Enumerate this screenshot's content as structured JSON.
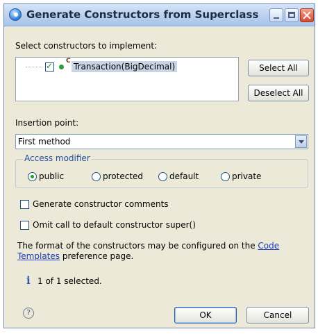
{
  "window": {
    "title": "Generate Constructors from Superclass"
  },
  "constructors": {
    "label": "Select constructors to implement:",
    "items": [
      {
        "label": "Transaction(BigDecimal)",
        "checked": true,
        "badge": "C"
      }
    ],
    "select_all": "Select All",
    "deselect_all": "Deselect All"
  },
  "insertion": {
    "label": "Insertion point:",
    "value": "First method"
  },
  "access": {
    "title": "Access modifier",
    "options": [
      "public",
      "protected",
      "default",
      "private"
    ],
    "selected": "public"
  },
  "options": {
    "generate_comments": "Generate constructor comments",
    "omit_super": "Omit call to default constructor super()"
  },
  "note": {
    "text_before": "The format of the constructors may be configured on the ",
    "link1": "Code",
    "link2": "Templates",
    "text_after": " preference page."
  },
  "status": {
    "text": "1 of 1 selected.",
    "icon": "info-icon"
  },
  "footer": {
    "help_icon": "help-icon",
    "ok": "OK",
    "cancel": "Cancel"
  }
}
